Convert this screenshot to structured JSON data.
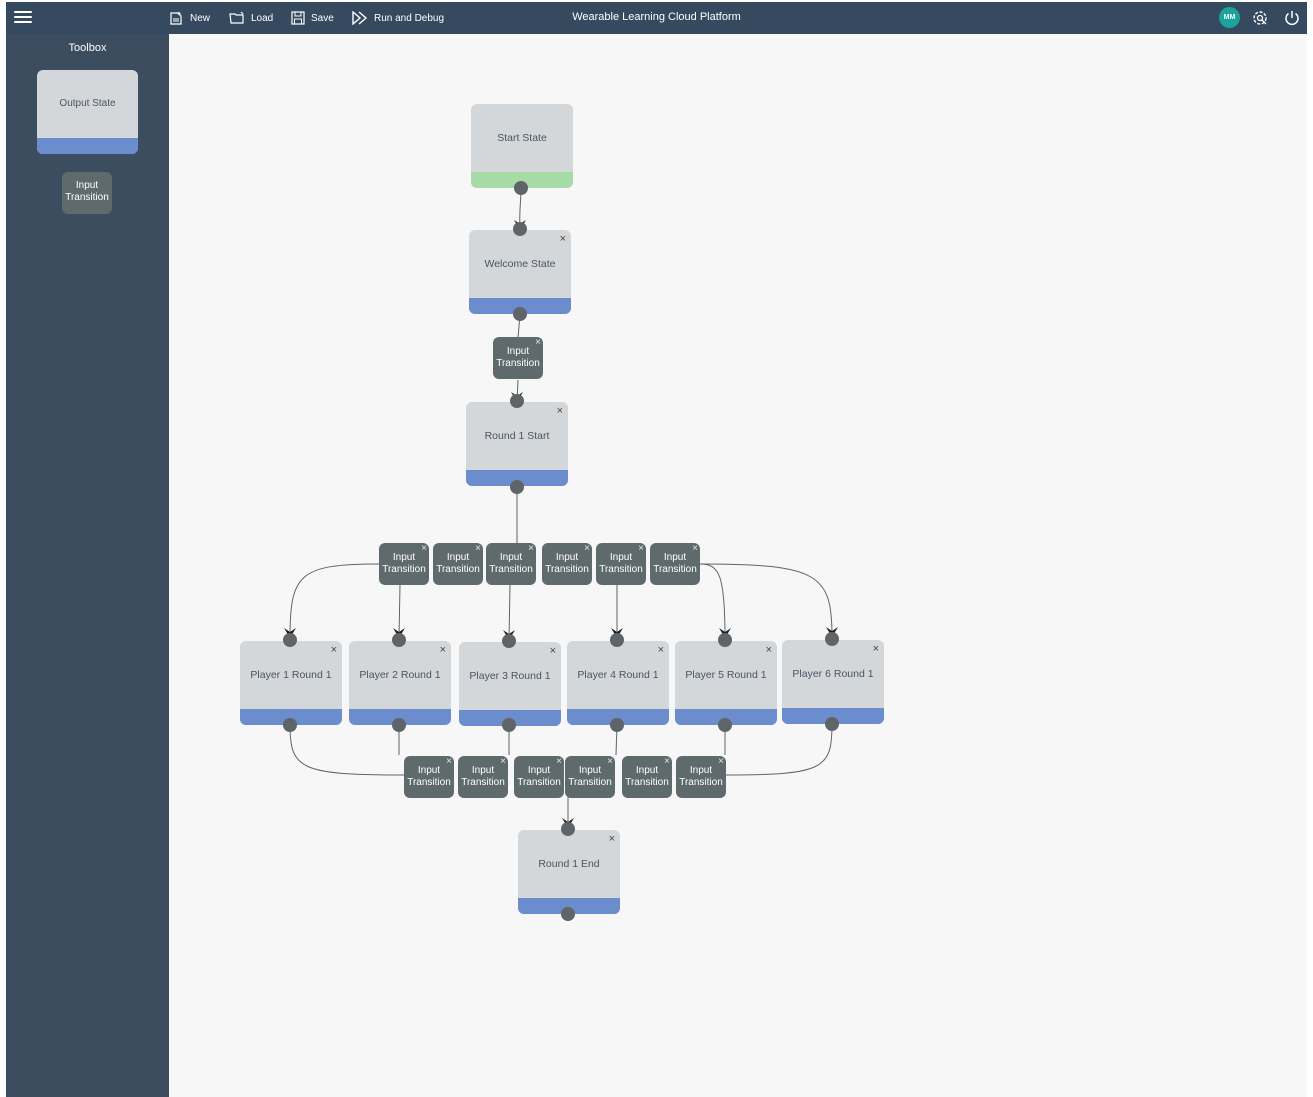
{
  "window": {
    "title": "Wearable Learning Cloud Platform"
  },
  "toolbar": {
    "new_label": "New",
    "load_label": "Load",
    "save_label": "Save",
    "run_label": "Run and Debug",
    "avatar_initials": "MM"
  },
  "toolbox": {
    "title": "Toolbox",
    "output_state_label": "Output State",
    "input_transition_label": "Input Transition"
  },
  "colors": {
    "topbar": "#354a5f",
    "sidebar": "#3c4d5f",
    "state_bar": "#6b8ccd",
    "start_bar": "#a7dba6",
    "transition": "#5f6a6d",
    "avatar": "#1ba39c"
  },
  "graph": {
    "close_glyph": "×",
    "states": [
      {
        "label": "Start State",
        "kind": "start",
        "closable": false
      },
      {
        "label": "Welcome State",
        "kind": "output",
        "closable": true
      },
      {
        "label": "Round 1 Start",
        "kind": "output",
        "closable": true
      },
      {
        "label": "Player 1 Round 1",
        "kind": "output",
        "closable": true
      },
      {
        "label": "Player 2 Round 1",
        "kind": "output",
        "closable": true
      },
      {
        "label": "Player 3 Round 1",
        "kind": "output",
        "closable": true
      },
      {
        "label": "Player 4 Round 1",
        "kind": "output",
        "closable": true
      },
      {
        "label": "Player 5 Round 1",
        "kind": "output",
        "closable": true
      },
      {
        "label": "Player 6 Round 1",
        "kind": "output",
        "closable": true
      },
      {
        "label": "Round 1 End",
        "kind": "output",
        "closable": true
      }
    ],
    "transition_label": "Input Transition",
    "transition_count": 13
  }
}
